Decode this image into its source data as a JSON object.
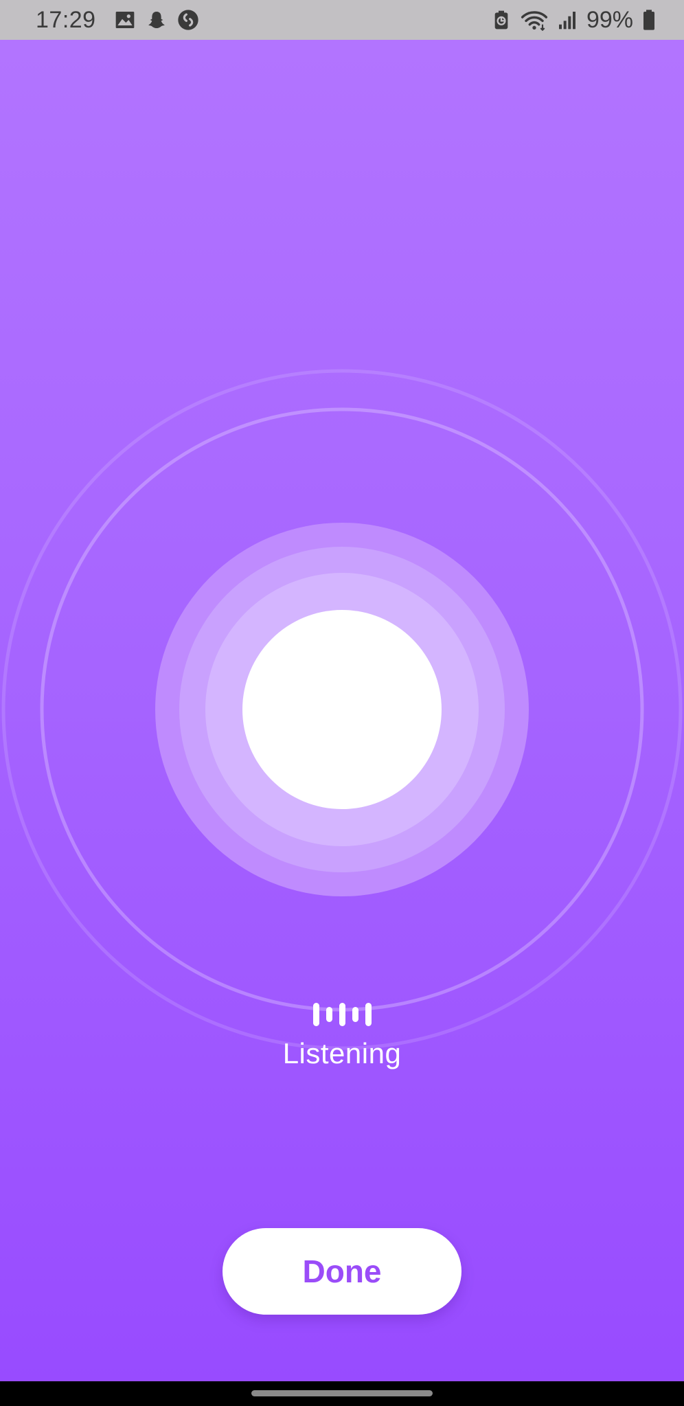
{
  "status_bar": {
    "time": "17:29",
    "battery": "99%",
    "left_icons": [
      "gallery-icon",
      "snapchat-icon",
      "shazam-icon"
    ],
    "right_icons": [
      "battery-saver-icon",
      "wifi-icon",
      "signal-icon",
      "battery-icon"
    ]
  },
  "assistant": {
    "status_label": "Listening",
    "wave_icon": "sound-wave-icon"
  },
  "actions": {
    "done_label": "Done"
  },
  "colors": {
    "gradient_top": "#b274ff",
    "gradient_bottom": "#984bff",
    "accent": "#9a4cf8",
    "status_bar_bg": "#c2c0c3"
  }
}
